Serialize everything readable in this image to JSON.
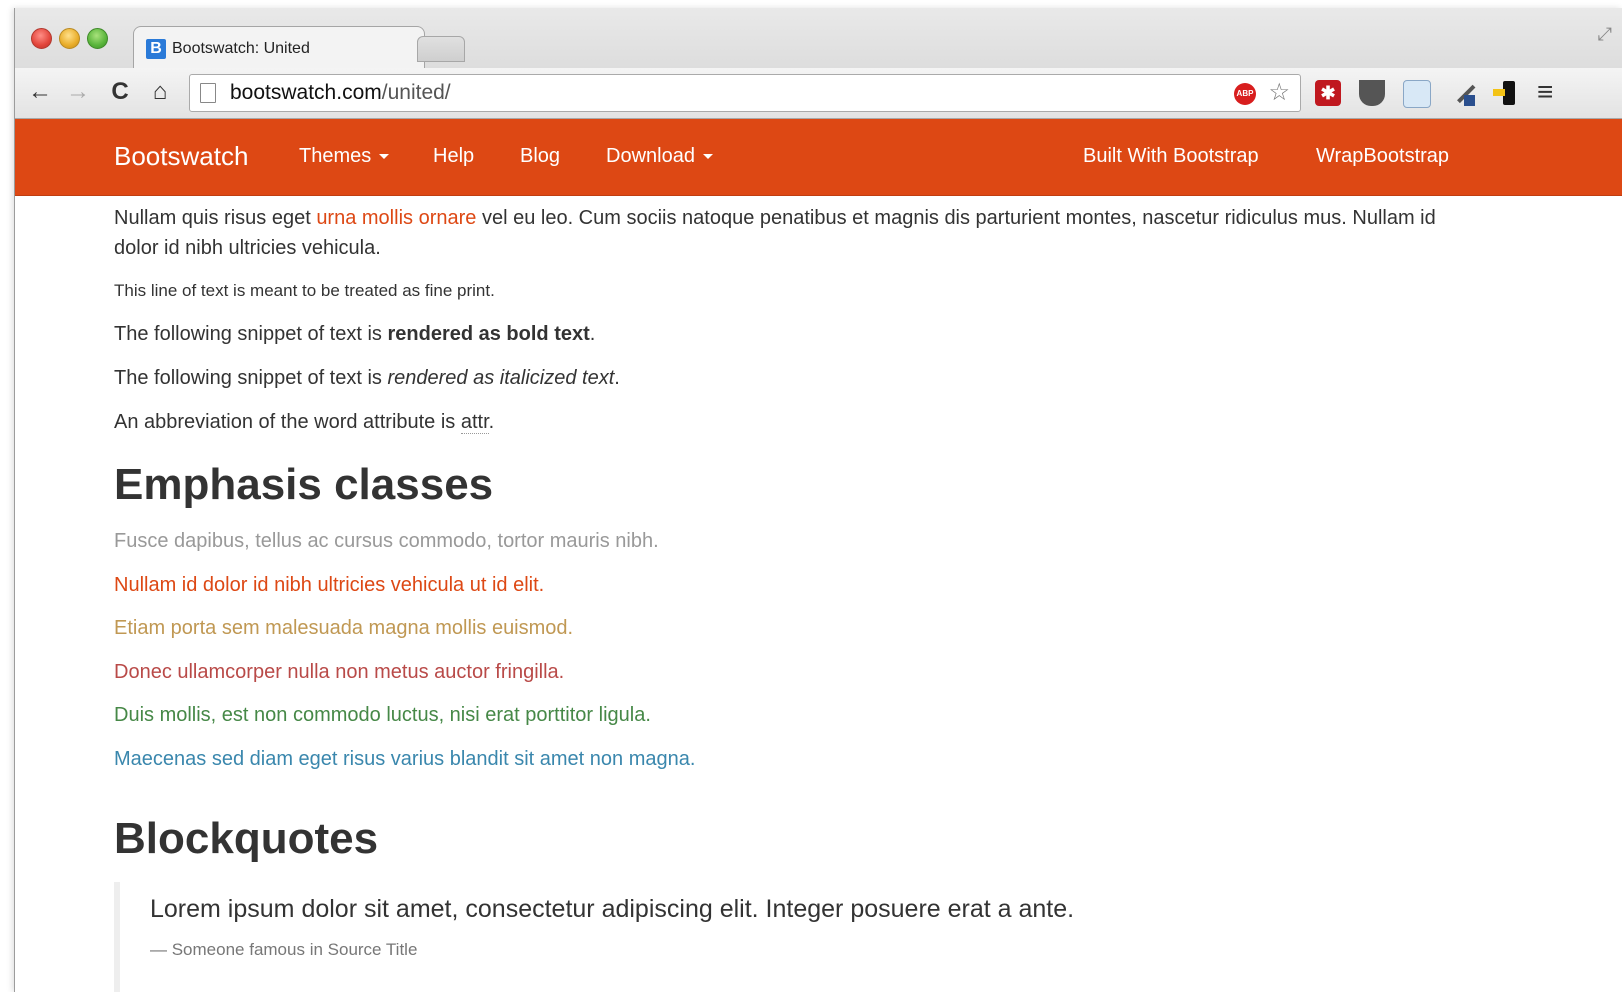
{
  "browser": {
    "tab_title": "Bootswatch: United",
    "tab_favicon": "B",
    "tab_close": "×",
    "url_domain": "bootswatch.com",
    "url_path": "/united/",
    "icons": {
      "back": "←",
      "forward": "→",
      "reload": "C",
      "home": "⌂",
      "star": "☆",
      "menu": "≡",
      "fullscreen": "⤢",
      "abp": "ABP",
      "lastpass": "✱"
    }
  },
  "navbar": {
    "color": "#dd4814",
    "brand": "Bootswatch",
    "items": [
      {
        "label": "Themes",
        "dropdown": true
      },
      {
        "label": "Help",
        "dropdown": false
      },
      {
        "label": "Blog",
        "dropdown": false
      },
      {
        "label": "Download",
        "dropdown": true
      }
    ],
    "right_items": [
      {
        "label": "Built With Bootstrap"
      },
      {
        "label": "WrapBootstrap"
      }
    ]
  },
  "content": {
    "intro": {
      "before_link": "Nullam quis risus eget ",
      "link": "urna mollis ornare",
      "after_link": " vel eu leo. Cum sociis natoque penatibus et magnis dis parturient montes, nascetur ridiculus mus. Nullam id dolor id nibh ultricies vehicula."
    },
    "fine_print": "This line of text is meant to be treated as fine print.",
    "bold_line": {
      "before": "The following snippet of text is ",
      "bold": "rendered as bold text",
      "after": "."
    },
    "italic_line": {
      "before": "The following snippet of text is ",
      "italic": "rendered as italicized text",
      "after": "."
    },
    "abbr_line": {
      "before": "An abbreviation of the word attribute is ",
      "abbr": "attr",
      "after": "."
    },
    "emphasis_heading": "Emphasis classes",
    "emphasis": [
      {
        "text": "Fusce dapibus, tellus ac cursus commodo, tortor mauris nibh.",
        "color": "#999999"
      },
      {
        "text": "Nullam id dolor id nibh ultricies vehicula ut id elit.",
        "color": "#dd4814"
      },
      {
        "text": "Etiam porta sem malesuada magna mollis euismod.",
        "color": "#c09853"
      },
      {
        "text": "Donec ullamcorper nulla non metus auctor fringilla.",
        "color": "#b94a48"
      },
      {
        "text": "Duis mollis, est non commodo luctus, nisi erat porttitor ligula.",
        "color": "#468847"
      },
      {
        "text": "Maecenas sed diam eget risus varius blandit sit amet non magna.",
        "color": "#3a87ad"
      }
    ],
    "blockquotes_heading": "Blockquotes",
    "blockquote": {
      "text": "Lorem ipsum dolor sit amet, consectetur adipiscing elit. Integer posuere erat a ante.",
      "cite": "— Someone famous in Source Title"
    }
  }
}
